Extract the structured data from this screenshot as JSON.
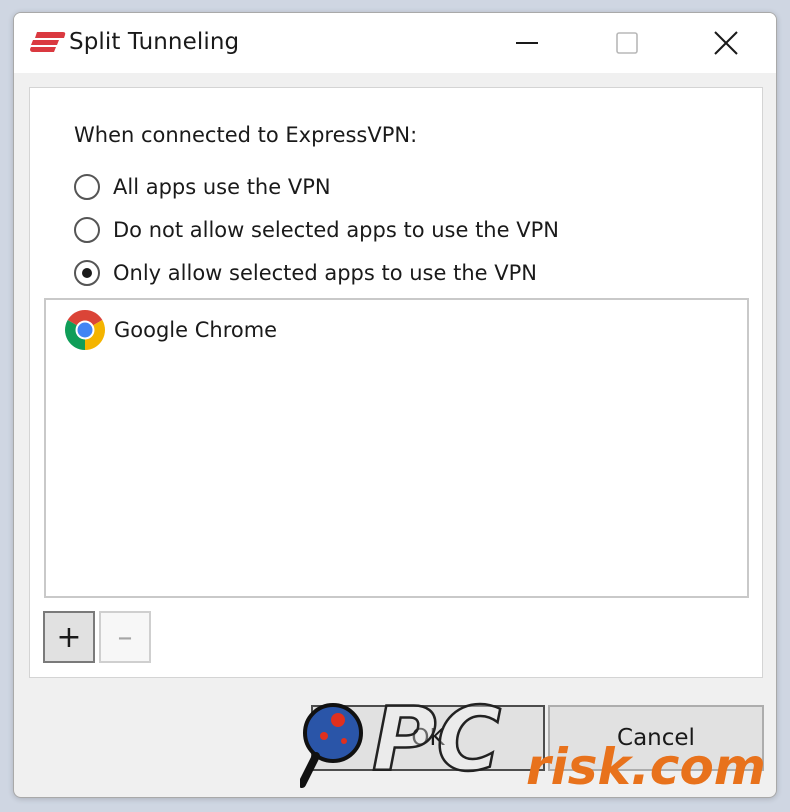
{
  "window": {
    "title": "Split Tunneling",
    "brand_color": "#da3940"
  },
  "settings": {
    "heading": "When connected to ExpressVPN:",
    "options": [
      {
        "label": "All apps use the VPN",
        "selected": false
      },
      {
        "label": "Do not allow selected apps to use the VPN",
        "selected": false
      },
      {
        "label": "Only allow selected apps to use the VPN",
        "selected": true
      }
    ],
    "apps": [
      {
        "name": "Google Chrome",
        "icon": "chrome-icon"
      }
    ],
    "add_label": "+",
    "remove_label": "–"
  },
  "footer": {
    "ok_label": "OK",
    "cancel_label": "Cancel"
  },
  "watermark": {
    "logo": "PCrisk.com"
  }
}
